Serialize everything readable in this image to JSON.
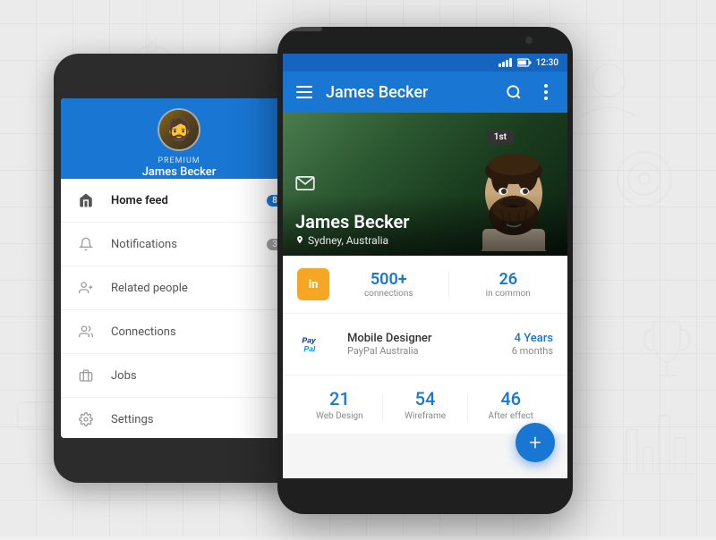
{
  "background": {
    "color": "#ebebeb"
  },
  "back_phone": {
    "header": {
      "premium_label": "PREMIUM",
      "user_name": "James Becker"
    },
    "nav": [
      {
        "id": "home-feed",
        "label": "Home feed",
        "active": true,
        "badge": "8",
        "badge_color": "blue",
        "icon": "home"
      },
      {
        "id": "notifications",
        "label": "Notifications",
        "active": false,
        "badge": "3",
        "badge_color": "grey",
        "icon": "bell"
      },
      {
        "id": "related-people",
        "label": "Related people",
        "active": false,
        "badge": null,
        "icon": "person-add"
      },
      {
        "id": "connections",
        "label": "Connections",
        "active": false,
        "badge": null,
        "icon": "people"
      },
      {
        "id": "jobs",
        "label": "Jobs",
        "active": false,
        "badge": null,
        "icon": "briefcase"
      },
      {
        "id": "settings",
        "label": "Settings",
        "active": false,
        "badge": null,
        "icon": "gear"
      }
    ]
  },
  "front_phone": {
    "status_bar": {
      "time": "12:30"
    },
    "app_bar": {
      "title": "James Becker",
      "menu_icon": "≡",
      "search_icon": "🔍",
      "more_icon": "⋮"
    },
    "profile": {
      "name": "James Becker",
      "location": "Sydney, Australia",
      "badge": "1st"
    },
    "stats": {
      "connections_count": "500+",
      "connections_label": "connections",
      "common_count": "26",
      "common_label": "in common"
    },
    "job": {
      "title": "Mobile Designer",
      "company": "PayPal Australia",
      "duration_years": "4 Years",
      "duration_months": "6 months"
    },
    "skills": [
      {
        "count": "21",
        "label": "Web Design"
      },
      {
        "count": "54",
        "label": "Wireframe"
      },
      {
        "count": "46",
        "label": "After effect"
      }
    ],
    "fab": "+"
  }
}
